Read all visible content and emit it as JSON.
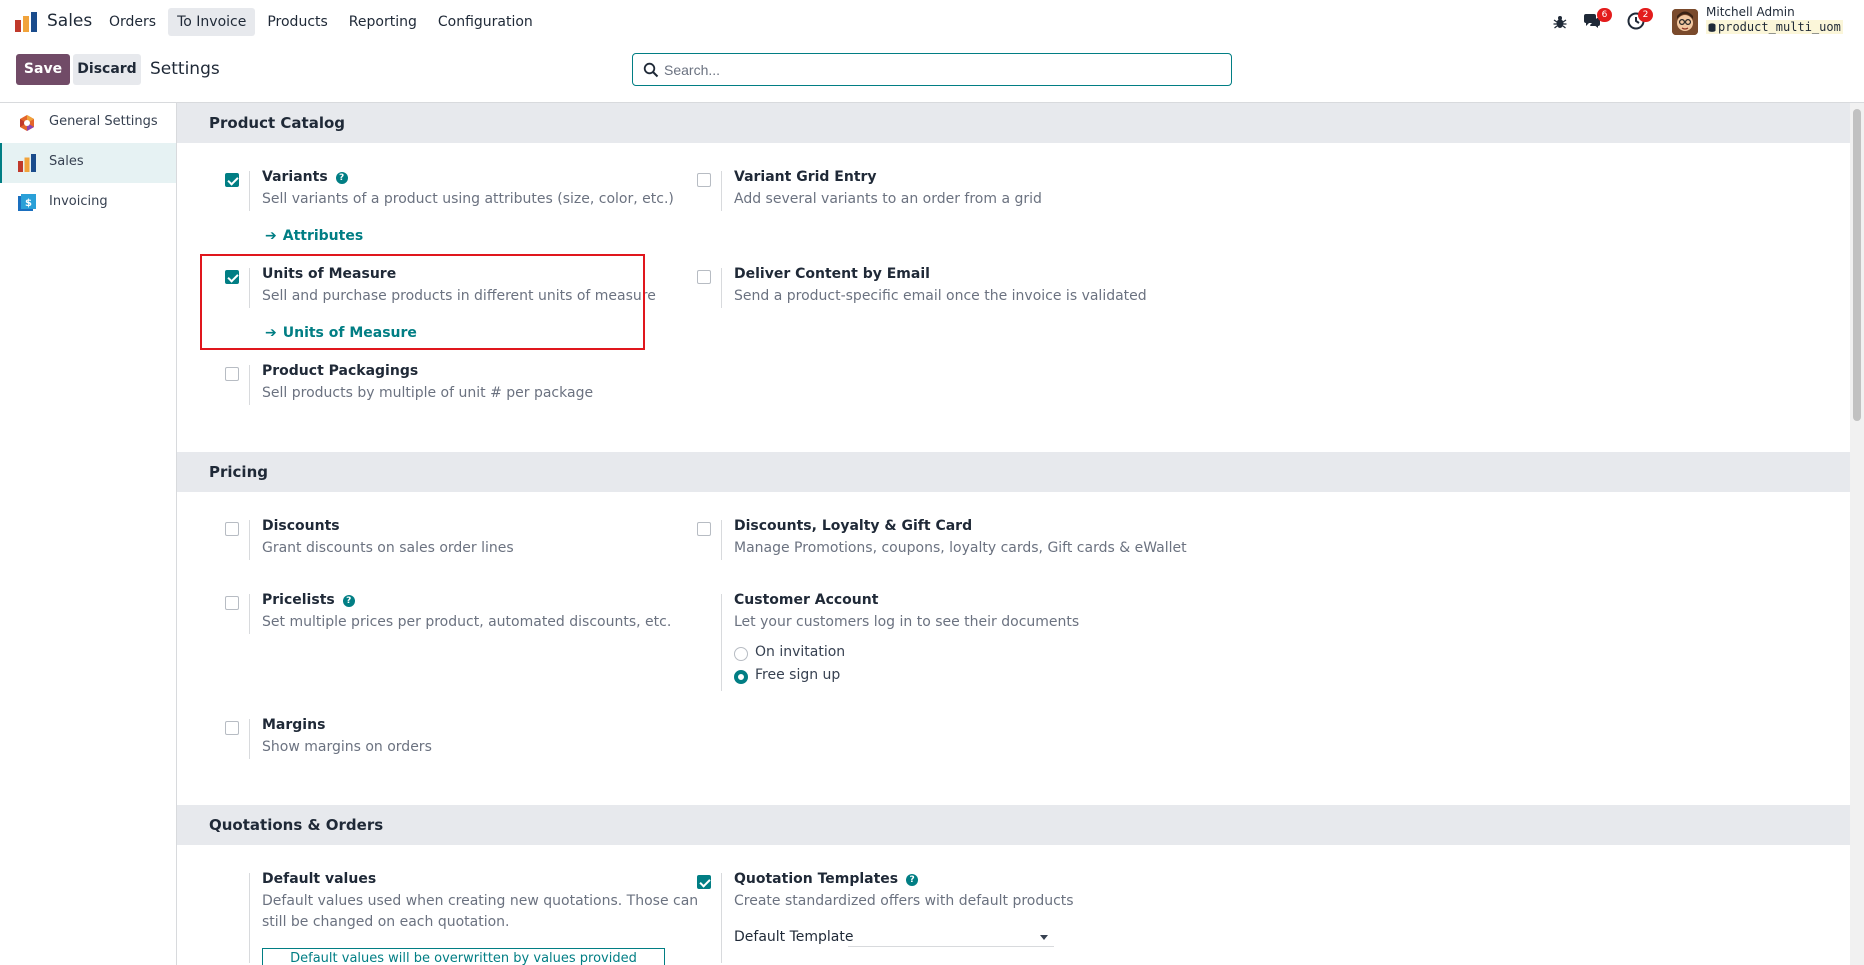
{
  "app": {
    "name": "Sales"
  },
  "menu": {
    "items": [
      {
        "label": "Orders"
      },
      {
        "label": "To Invoice"
      },
      {
        "label": "Products"
      },
      {
        "label": "Reporting"
      },
      {
        "label": "Configuration"
      }
    ]
  },
  "systray": {
    "bug_icon": "bug-icon",
    "messages_count": "6",
    "activity_count": "2",
    "user_name": "Mitchell Admin",
    "database": "product_multi_uom"
  },
  "control_panel": {
    "save_label": "Save",
    "discard_label": "Discard",
    "title": "Settings",
    "search_placeholder": "Search..."
  },
  "sidebar": {
    "items": [
      {
        "label": "General Settings",
        "icon": "odoo-settings-icon"
      },
      {
        "label": "Sales",
        "icon": "sales-app-icon",
        "active": true
      },
      {
        "label": "Invoicing",
        "icon": "invoicing-app-icon"
      }
    ]
  },
  "sections": {
    "product_catalog": {
      "title": "Product Catalog",
      "variants": {
        "title": "Variants",
        "desc": "Sell variants of a product using attributes (size, color, etc.)",
        "link": "Attributes",
        "checked": true
      },
      "variant_grid": {
        "title": "Variant Grid Entry",
        "desc": "Add several variants to an order from a grid",
        "checked": false
      },
      "uom": {
        "title": "Units of Measure",
        "desc": "Sell and purchase products in different units of measure",
        "link": "Units of Measure",
        "checked": true
      },
      "deliver_email": {
        "title": "Deliver Content by Email",
        "desc": "Send a product-specific email once the invoice is validated",
        "checked": false
      },
      "packagings": {
        "title": "Product Packagings",
        "desc": "Sell products by multiple of unit # per package",
        "checked": false
      }
    },
    "pricing": {
      "title": "Pricing",
      "discounts": {
        "title": "Discounts",
        "desc": "Grant discounts on sales order lines",
        "checked": false
      },
      "loyalty": {
        "title": "Discounts, Loyalty & Gift Card",
        "desc": "Manage Promotions, coupons, loyalty cards, Gift cards & eWallet",
        "checked": false
      },
      "pricelists": {
        "title": "Pricelists",
        "desc": "Set multiple prices per product, automated discounts, etc.",
        "checked": false
      },
      "customer_account": {
        "title": "Customer Account",
        "desc": "Let your customers log in to see their documents",
        "options": [
          "On invitation",
          "Free sign up"
        ],
        "selected": "Free sign up"
      },
      "margins": {
        "title": "Margins",
        "desc": "Show margins on orders",
        "checked": false
      }
    },
    "quotations": {
      "title": "Quotations & Orders",
      "default_values": {
        "title": "Default values",
        "desc_line1": "Default values used when creating new quotations. Those can",
        "desc_line2": "still be changed on each quotation.",
        "button": "Default values will be overwritten by values provided"
      },
      "quotation_templates": {
        "title": "Quotation Templates",
        "desc": "Create standardized offers with default products",
        "checked": true,
        "field_label": "Default Template",
        "field_value": ""
      }
    }
  }
}
